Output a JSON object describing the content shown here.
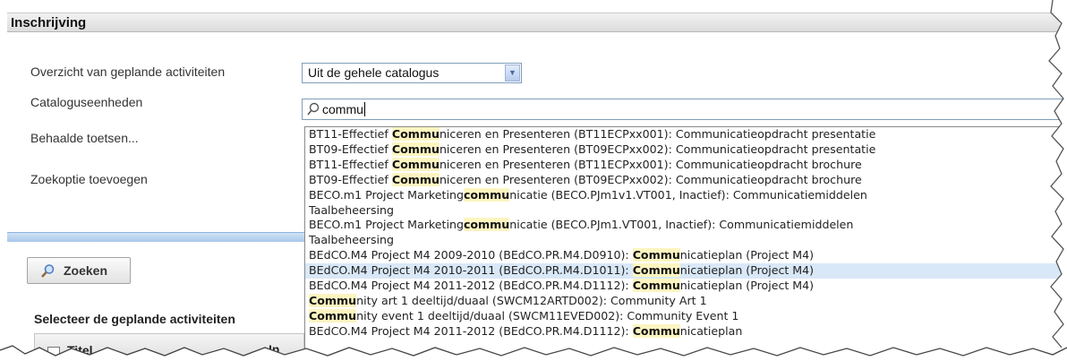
{
  "panel": {
    "title": "Inschrijving"
  },
  "form": {
    "overview_label": "Overzicht van geplande activiteiten",
    "overview_value": "Uit de gehele catalogus",
    "catalog_label": "Cataloguseenheden",
    "search_value": "commu",
    "passed_tests_label": "Behaalde toetsen...",
    "add_option_label": "Zoekoptie toevoegen"
  },
  "search_button": {
    "label": "Zoeken",
    "icon": "search-icon"
  },
  "selection": {
    "title": "Selecteer de geplande activiteiten",
    "col_title": "Titel",
    "col_in": "In"
  },
  "results": [
    {
      "pre": "BT11-Effectief ",
      "match": "Commu",
      "post": "niceren en Presenteren (BT11ECPxx001): Communicatieopdracht presentatie"
    },
    {
      "pre": "BT09-Effectief ",
      "match": "Commu",
      "post": "niceren en Presenteren (BT09ECPxx002): Communicatieopdracht presentatie"
    },
    {
      "pre": "BT11-Effectief ",
      "match": "Commu",
      "post": "niceren en Presenteren (BT11ECPxx001): Communicatieopdracht brochure"
    },
    {
      "pre": "BT09-Effectief ",
      "match": "Commu",
      "post": "niceren en Presenteren (BT09ECPxx002): Communicatieopdracht brochure"
    },
    {
      "pre": "BECO.m1 Project Marketing",
      "match": "commu",
      "post": "nicatie (BECO.PJm1v1.VT001, Inactief): Communicatiemiddelen"
    },
    {
      "pre": "Taalbeheersing",
      "match": "",
      "post": ""
    },
    {
      "pre": "BECO.m1 Project Marketing",
      "match": "commu",
      "post": "nicatie (BECO.PJm1.VT001, Inactief): Communicatiemiddelen"
    },
    {
      "pre": "Taalbeheersing",
      "match": "",
      "post": ""
    },
    {
      "pre": "BEdCO.M4 Project M4 2009-2010 (BEdCO.PR.M4.D0910): ",
      "match": "Commu",
      "post": "nicatieplan (Project M4)"
    },
    {
      "pre": "BEdCO.M4 Project M4 2010-2011 (BEdCO.PR.M4.D1011): ",
      "match": "Commu",
      "post": "nicatieplan (Project M4)",
      "highlighted": true
    },
    {
      "pre": "BEdCO.M4 Project M4 2011-2012 (BEdCO.PR.M4.D1112): ",
      "match": "Commu",
      "post": "nicatieplan (Project M4)"
    },
    {
      "pre": "",
      "match": "Commu",
      "post": "nity art 1 deeltijd/duaal (SWCM12ARTD002): Community Art 1"
    },
    {
      "pre": "",
      "match": "Commu",
      "post": "nity event 1 deeltijd/duaal (SWCM11EVED002): Community Event 1"
    },
    {
      "pre": "BEdCO.M4 Project M4 2011-2012 (BEdCO.PR.M4.D1112): ",
      "match": "Commu",
      "post": "nicatieplan"
    }
  ]
}
